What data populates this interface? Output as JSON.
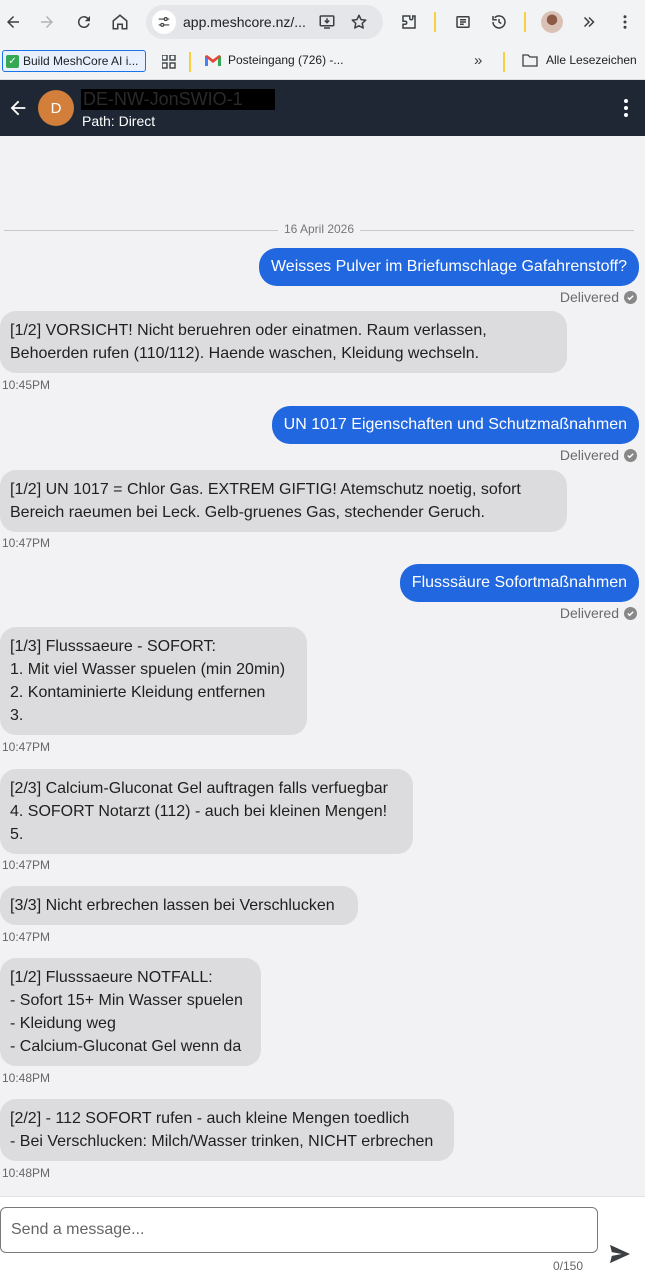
{
  "browser": {
    "url": "app.meshcore.nz/...",
    "bookmarks": {
      "active_label": "Build MeshCore AI i...",
      "mail_label": "Posteingang (726) -...",
      "more": "»",
      "all_label": "Alle Lesezeichen"
    }
  },
  "header": {
    "avatar_letter": "D",
    "contact_name": "DE-NW-JonSWIO-1",
    "path": "Path: Direct"
  },
  "chat": {
    "date": "16 April 2026",
    "outgoing": [
      {
        "text": "Weisses Pulver im Briefumschlage Gafahrenstoff?",
        "status": "Delivered"
      },
      {
        "text": "UN 1017 Eigenschaften und Schutzmaßnahmen",
        "status": "Delivered"
      },
      {
        "text": "Flusssäure Sofortmaßnahmen",
        "status": "Delivered"
      }
    ],
    "incoming": [
      {
        "text": "[1/2] VORSICHT! Nicht beruehren oder einatmen. Raum verlassen,\nBehoerden rufen (110/112). Haende waschen, Kleidung wechseln.",
        "time": "10:45PM"
      },
      {
        "text": "[1/2] UN 1017 = Chlor Gas. EXTREM GIFTIG! Atemschutz noetig, sofort\nBereich raeumen bei Leck. Gelb-gruenes Gas, stechender Geruch.",
        "time": "10:47PM"
      },
      {
        "text": "[1/3] Flusssaeure - SOFORT:\n1. Mit viel Wasser spuelen (min 20min)\n2. Kontaminierte Kleidung entfernen\n3.",
        "time": "10:47PM"
      },
      {
        "text": "[2/3] Calcium-Gluconat Gel auftragen falls verfuegbar\n4. SOFORT Notarzt (112) - auch bei kleinen Mengen!\n5.",
        "time": "10:47PM"
      },
      {
        "text": "[3/3] Nicht erbrechen lassen bei Verschlucken",
        "time": "10:47PM"
      },
      {
        "text": "[1/2] Flusssaeure NOTFALL:\n- Sofort 15+ Min Wasser spuelen\n- Kleidung weg\n- Calcium-Gluconat Gel wenn da",
        "time": "10:48PM"
      },
      {
        "text": "[2/2] - 112 SOFORT rufen - auch kleine Mengen toedlich\n- Bei Verschlucken: Milch/Wasser trinken, NICHT erbrechen",
        "time": "10:48PM"
      }
    ]
  },
  "composer": {
    "placeholder": "Send a message...",
    "counter": "0/150"
  },
  "colors": {
    "header_bg": "#1e2733",
    "outgoing_bubble": "#2167e0",
    "incoming_bubble": "#dcdcde",
    "avatar": "#d17f3a",
    "chat_bg": "#f2f2f4"
  },
  "icons": [
    "back-icon",
    "forward-icon",
    "reload-icon",
    "home-icon",
    "site-settings-icon",
    "install-app-icon",
    "bookmark-star-icon",
    "extensions-icon",
    "reading-list-icon",
    "history-icon",
    "more-tools-icon",
    "menu-icon",
    "apps-grid-icon",
    "gmail-icon",
    "folder-icon",
    "arrow-left-icon",
    "kebab-menu-icon",
    "check-circle-icon",
    "send-icon"
  ]
}
